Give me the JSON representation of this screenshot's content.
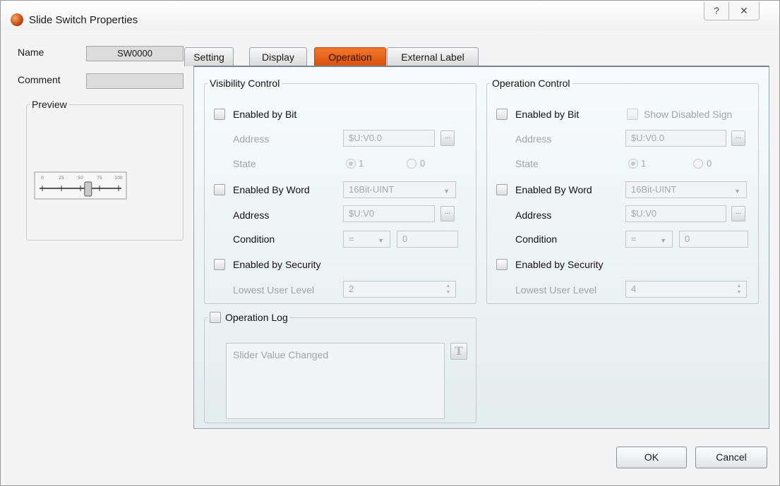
{
  "window": {
    "title": "Slide Switch Properties",
    "help_glyph": "?",
    "close_glyph": "✕"
  },
  "general": {
    "name_label": "Name",
    "name_value": "SW0000",
    "comment_label": "Comment",
    "comment_value": "",
    "preview_label": "Preview",
    "preview_ticks": [
      "0",
      "25",
      "50",
      "75",
      "100"
    ],
    "preview_slider_value": 60
  },
  "tabs": [
    {
      "label": "Setting",
      "active": false
    },
    {
      "label": "Display",
      "active": false
    },
    {
      "label": "Operation",
      "active": true
    },
    {
      "label": "External Label",
      "active": false
    }
  ],
  "visibility": {
    "title": "Visibility Control",
    "enabled_by_bit": {
      "label": "Enabled by Bit",
      "checked": false
    },
    "address_label": "Address",
    "bit_address": "$U:V0.0",
    "state_label": "State",
    "state_options": [
      "1",
      "0"
    ],
    "state_selected": "1",
    "enabled_by_word": {
      "label": "Enabled By Word",
      "checked": false
    },
    "word_type": "16Bit-UINT",
    "word_address": "$U:V0",
    "condition_label": "Condition",
    "condition_operator": "=",
    "condition_value": "0",
    "enabled_by_security": {
      "label": "Enabled by Security",
      "checked": false
    },
    "lowest_user_level_label": "Lowest User Level",
    "lowest_user_level": "2"
  },
  "operation": {
    "title": "Operation Control",
    "enabled_by_bit": {
      "label": "Enabled by Bit",
      "checked": false
    },
    "show_disabled_sign": {
      "label": "Show Disabled Sign",
      "checked": false
    },
    "address_label": "Address",
    "bit_address": "$U:V0.0",
    "state_label": "State",
    "state_options": [
      "1",
      "0"
    ],
    "state_selected": "1",
    "enabled_by_word": {
      "label": "Enabled By Word",
      "checked": false
    },
    "word_type": "16Bit-UINT",
    "word_address": "$U:V0",
    "condition_label": "Condition",
    "condition_operator": "=",
    "condition_value": "0",
    "enabled_by_security": {
      "label": "Enabled by Security",
      "checked": false
    },
    "lowest_user_level_label": "Lowest User Level",
    "lowest_user_level": "4"
  },
  "operation_log": {
    "label": "Operation Log",
    "checked": false,
    "text": "Slider Value Changed",
    "text_button_glyph": "T"
  },
  "buttons": {
    "browse_glyph": "...",
    "ok": "OK",
    "cancel": "Cancel"
  },
  "colors": {
    "active_tab": "#e8621a"
  }
}
